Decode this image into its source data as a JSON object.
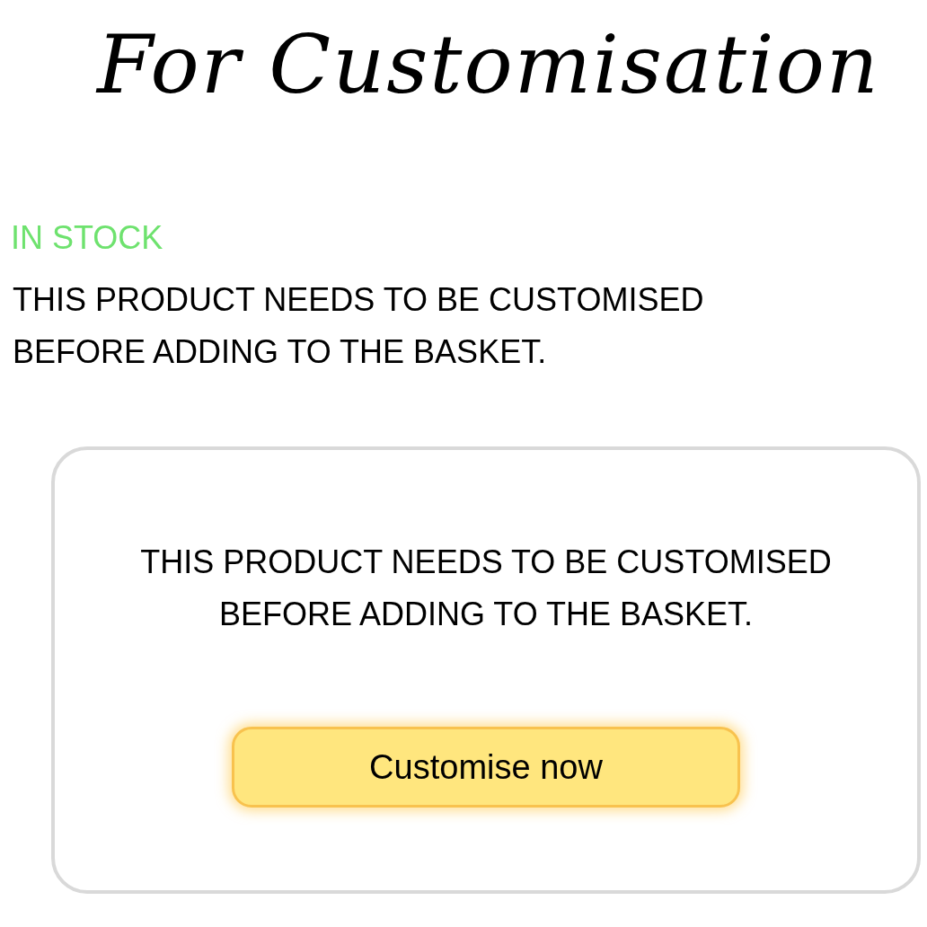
{
  "heading": "For Customisation",
  "stock": {
    "label": "IN STOCK",
    "available": true
  },
  "notice": "THIS PRODUCT NEEDS TO BE CUSTOMISED BEFORE ADDING TO THE BASKET.",
  "card": {
    "message": "THIS PRODUCT NEEDS TO BE CUSTOMISED BEFORE ADDING TO THE BASKET.",
    "button": "Customise now"
  }
}
